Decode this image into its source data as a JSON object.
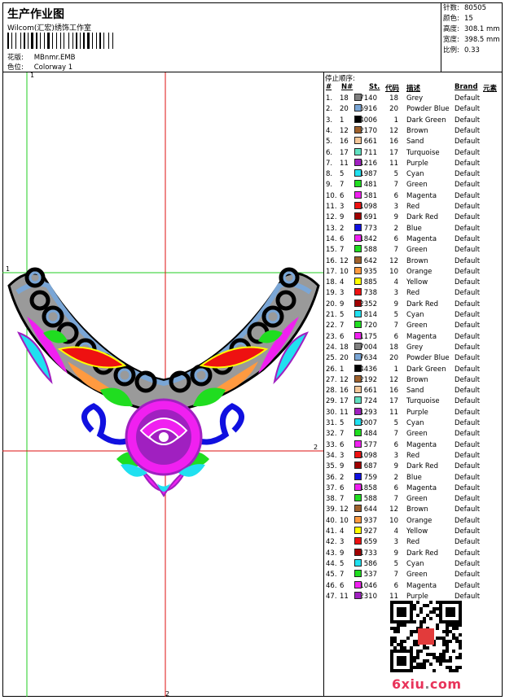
{
  "header": {
    "title": "生产作业图",
    "subtitle": "Wilcom(汇宏)绣饰工作室",
    "pattern_label": "花版:",
    "pattern_value": "MBnmr.EMB",
    "colorway_label": "色位:",
    "colorway_value": "Colorway 1"
  },
  "stats": {
    "stitches_label": "针数:",
    "stitches_value": "80505",
    "colors_label": "颜色:",
    "colors_value": "15",
    "height_label": "高度:",
    "height_value": "308.1 mm",
    "width_label": "宽度:",
    "width_value": "398.5 mm",
    "scale_label": "比例:",
    "scale_value": "0.33"
  },
  "canvas": {
    "guide_color": "#22cc22",
    "axis_color": "#dd1111",
    "guides": {
      "h1_label": "1",
      "v1_label": "1",
      "h2_label": "2",
      "v2_label": "2"
    }
  },
  "stop_sequence": {
    "title": "停止顺序:",
    "headers": {
      "hash": "#",
      "needle": "N#",
      "stitches": "St.",
      "code": "代码",
      "desc": "描述",
      "brand": "Brand",
      "elem": "元素"
    },
    "rows": [
      {
        "n": "1.",
        "needle": "18",
        "color": "#808080",
        "st": "7140",
        "code": "18",
        "desc": "Grey",
        "brand": "Default"
      },
      {
        "n": "2.",
        "needle": "20",
        "color": "#7aa6d6",
        "st": "6916",
        "code": "20",
        "desc": "Powder Blue",
        "brand": "Default"
      },
      {
        "n": "3.",
        "needle": "1",
        "color": "#000000",
        "st": "4006",
        "code": "1",
        "desc": "Dark Green",
        "brand": "Default"
      },
      {
        "n": "4.",
        "needle": "12",
        "color": "#a0622d",
        "st": "2170",
        "code": "12",
        "desc": "Brown",
        "brand": "Default"
      },
      {
        "n": "5.",
        "needle": "16",
        "color": "#f5c89a",
        "st": "661",
        "code": "16",
        "desc": "Sand",
        "brand": "Default"
      },
      {
        "n": "6.",
        "needle": "17",
        "color": "#60e0c0",
        "st": "711",
        "code": "17",
        "desc": "Turquoise",
        "brand": "Default"
      },
      {
        "n": "7.",
        "needle": "11",
        "color": "#a020c0",
        "st": "1216",
        "code": "11",
        "desc": "Purple",
        "brand": "Default"
      },
      {
        "n": "8.",
        "needle": "5",
        "color": "#20e0f0",
        "st": "1987",
        "code": "5",
        "desc": "Cyan",
        "brand": "Default"
      },
      {
        "n": "9.",
        "needle": "7",
        "color": "#20dd20",
        "st": "481",
        "code": "7",
        "desc": "Green",
        "brand": "Default"
      },
      {
        "n": "10.",
        "needle": "6",
        "color": "#f020f0",
        "st": "581",
        "code": "6",
        "desc": "Magenta",
        "brand": "Default"
      },
      {
        "n": "11.",
        "needle": "3",
        "color": "#ee1111",
        "st": "1098",
        "code": "3",
        "desc": "Red",
        "brand": "Default"
      },
      {
        "n": "12.",
        "needle": "9",
        "color": "#a00000",
        "st": "691",
        "code": "9",
        "desc": "Dark Red",
        "brand": "Default"
      },
      {
        "n": "13.",
        "needle": "2",
        "color": "#1010e0",
        "st": "773",
        "code": "2",
        "desc": "Blue",
        "brand": "Default"
      },
      {
        "n": "14.",
        "needle": "6",
        "color": "#f020f0",
        "st": "1842",
        "code": "6",
        "desc": "Magenta",
        "brand": "Default"
      },
      {
        "n": "15.",
        "needle": "7",
        "color": "#20dd20",
        "st": "588",
        "code": "7",
        "desc": "Green",
        "brand": "Default"
      },
      {
        "n": "16.",
        "needle": "12",
        "color": "#a0622d",
        "st": "642",
        "code": "12",
        "desc": "Brown",
        "brand": "Default"
      },
      {
        "n": "17.",
        "needle": "10",
        "color": "#ff9a40",
        "st": "935",
        "code": "10",
        "desc": "Orange",
        "brand": "Default"
      },
      {
        "n": "18.",
        "needle": "4",
        "color": "#ffff00",
        "st": "885",
        "code": "4",
        "desc": "Yellow",
        "brand": "Default"
      },
      {
        "n": "19.",
        "needle": "3",
        "color": "#ee1111",
        "st": "738",
        "code": "3",
        "desc": "Red",
        "brand": "Default"
      },
      {
        "n": "20.",
        "needle": "9",
        "color": "#a00000",
        "st": "2352",
        "code": "9",
        "desc": "Dark Red",
        "brand": "Default"
      },
      {
        "n": "21.",
        "needle": "5",
        "color": "#20e0f0",
        "st": "814",
        "code": "5",
        "desc": "Cyan",
        "brand": "Default"
      },
      {
        "n": "22.",
        "needle": "7",
        "color": "#20dd20",
        "st": "720",
        "code": "7",
        "desc": "Green",
        "brand": "Default"
      },
      {
        "n": "23.",
        "needle": "6",
        "color": "#f020f0",
        "st": "1175",
        "code": "6",
        "desc": "Magenta",
        "brand": "Default"
      },
      {
        "n": "24.",
        "needle": "18",
        "color": "#808080",
        "st": "7004",
        "code": "18",
        "desc": "Grey",
        "brand": "Default"
      },
      {
        "n": "25.",
        "needle": "20",
        "color": "#7aa6d6",
        "st": "7634",
        "code": "20",
        "desc": "Powder Blue",
        "brand": "Default"
      },
      {
        "n": "26.",
        "needle": "1",
        "color": "#000000",
        "st": "4436",
        "code": "1",
        "desc": "Dark Green",
        "brand": "Default"
      },
      {
        "n": "27.",
        "needle": "12",
        "color": "#a0622d",
        "st": "2192",
        "code": "12",
        "desc": "Brown",
        "brand": "Default"
      },
      {
        "n": "28.",
        "needle": "16",
        "color": "#f5c89a",
        "st": "661",
        "code": "16",
        "desc": "Sand",
        "brand": "Default"
      },
      {
        "n": "29.",
        "needle": "17",
        "color": "#60e0c0",
        "st": "724",
        "code": "17",
        "desc": "Turquoise",
        "brand": "Default"
      },
      {
        "n": "30.",
        "needle": "11",
        "color": "#a020c0",
        "st": "1293",
        "code": "11",
        "desc": "Purple",
        "brand": "Default"
      },
      {
        "n": "31.",
        "needle": "5",
        "color": "#20e0f0",
        "st": "2007",
        "code": "5",
        "desc": "Cyan",
        "brand": "Default"
      },
      {
        "n": "32.",
        "needle": "7",
        "color": "#20dd20",
        "st": "484",
        "code": "7",
        "desc": "Green",
        "brand": "Default"
      },
      {
        "n": "33.",
        "needle": "6",
        "color": "#f020f0",
        "st": "577",
        "code": "6",
        "desc": "Magenta",
        "brand": "Default"
      },
      {
        "n": "34.",
        "needle": "3",
        "color": "#ee1111",
        "st": "1098",
        "code": "3",
        "desc": "Red",
        "brand": "Default"
      },
      {
        "n": "35.",
        "needle": "9",
        "color": "#a00000",
        "st": "687",
        "code": "9",
        "desc": "Dark Red",
        "brand": "Default"
      },
      {
        "n": "36.",
        "needle": "2",
        "color": "#1010e0",
        "st": "759",
        "code": "2",
        "desc": "Blue",
        "brand": "Default"
      },
      {
        "n": "37.",
        "needle": "6",
        "color": "#f020f0",
        "st": "1858",
        "code": "6",
        "desc": "Magenta",
        "brand": "Default"
      },
      {
        "n": "38.",
        "needle": "7",
        "color": "#20dd20",
        "st": "588",
        "code": "7",
        "desc": "Green",
        "brand": "Default"
      },
      {
        "n": "39.",
        "needle": "12",
        "color": "#a0622d",
        "st": "644",
        "code": "12",
        "desc": "Brown",
        "brand": "Default"
      },
      {
        "n": "40.",
        "needle": "10",
        "color": "#ff9a40",
        "st": "937",
        "code": "10",
        "desc": "Orange",
        "brand": "Default"
      },
      {
        "n": "41.",
        "needle": "4",
        "color": "#ffff00",
        "st": "927",
        "code": "4",
        "desc": "Yellow",
        "brand": "Default"
      },
      {
        "n": "42.",
        "needle": "3",
        "color": "#ee1111",
        "st": "659",
        "code": "3",
        "desc": "Red",
        "brand": "Default"
      },
      {
        "n": "43.",
        "needle": "9",
        "color": "#a00000",
        "st": "1733",
        "code": "9",
        "desc": "Dark Red",
        "brand": "Default"
      },
      {
        "n": "44.",
        "needle": "5",
        "color": "#20e0f0",
        "st": "586",
        "code": "5",
        "desc": "Cyan",
        "brand": "Default"
      },
      {
        "n": "45.",
        "needle": "7",
        "color": "#20dd20",
        "st": "537",
        "code": "7",
        "desc": "Green",
        "brand": "Default"
      },
      {
        "n": "46.",
        "needle": "6",
        "color": "#f020f0",
        "st": "1046",
        "code": "6",
        "desc": "Magenta",
        "brand": "Default"
      },
      {
        "n": "47.",
        "needle": "11",
        "color": "#a020c0",
        "st": "2310",
        "code": "11",
        "desc": "Purple",
        "brand": "Default"
      }
    ]
  },
  "watermark": {
    "brand_a": "6xiu",
    "brand_dot": ".",
    "brand_b": "com"
  }
}
